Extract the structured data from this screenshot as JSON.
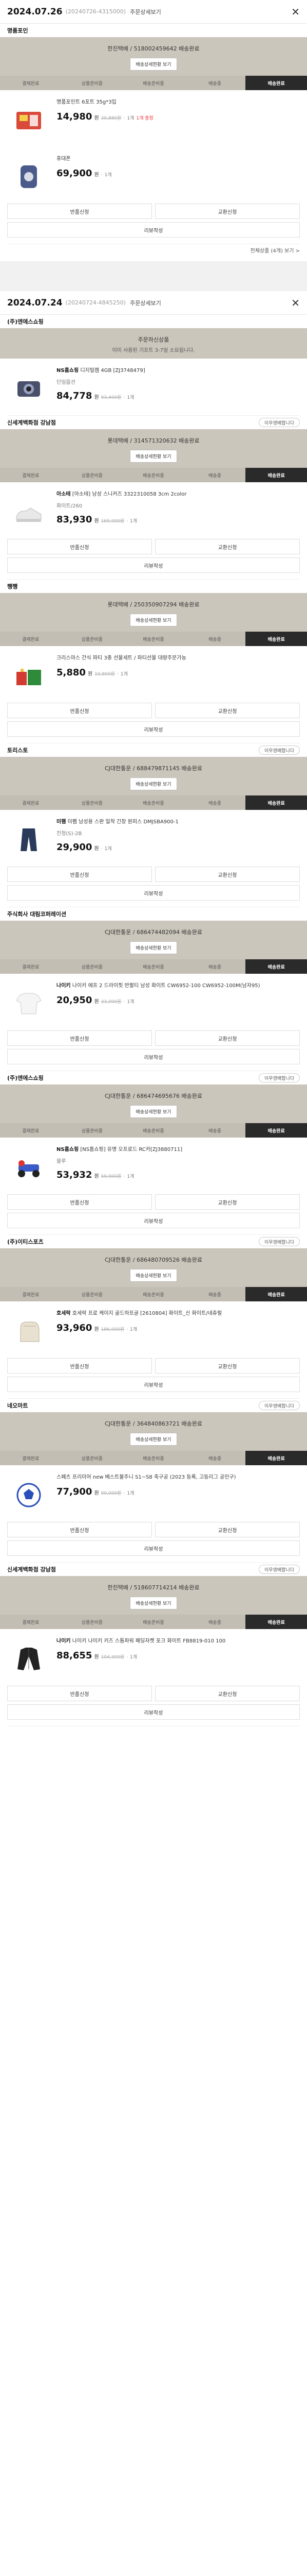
{
  "orders": [
    {
      "date": "2024.07.26",
      "no": "(20240726-4315000)",
      "detail": "주문상세보기",
      "groups": [
        {
          "shop": "명품포인",
          "pill": "",
          "delivery": {
            "title": "한진택배 / 518002459642 배송완료",
            "sub": "",
            "btn": "배송상세현황 보기"
          },
          "steps": [
            "결제완료",
            "상품준비중",
            "배송준비중",
            "배송중",
            "배송완료"
          ],
          "active": 4,
          "products": [
            {
              "brand": "",
              "name": "명품포인트 6포트 35g*3입",
              "opt": "",
              "price": "14,980",
              "old": "30,880원",
              "qty": "1개",
              "note": "1개 증정",
              "thumb": "box",
              "color": "#d94a3a"
            },
            {
              "brand": "",
              "name": "휴대폰",
              "opt": "",
              "price": "69,900",
              "old": "",
              "qty": "1개",
              "note": "",
              "thumb": "phone",
              "color": "#4a5a8a"
            }
          ],
          "actions": [
            "반품신청",
            "교환신청"
          ],
          "wide": "리뷰작성"
        }
      ],
      "more": "전체상품 (4개) 보기 >"
    },
    {
      "date": "2024.07.24",
      "no": "(20240724-4845250)",
      "detail": "주문상세보기",
      "groups": [
        {
          "shop": "(주)엔에스쇼핑",
          "pill": "",
          "delivery": {
            "title": "주문하신상품",
            "sub": "이미 사용된 기프트 3-7일 소요됩니다.",
            "btn": ""
          },
          "steps": [],
          "active": -1,
          "products": [
            {
              "brand": "NS홈쇼핑",
              "name": "디지털캠 4GB [ZJ3748479]",
              "opt": "단일옵션",
              "price": "84,778",
              "old": "93,400원",
              "qty": "1개",
              "note": "",
              "thumb": "cam",
              "color": "#4a4f6a"
            }
          ],
          "actions": [],
          "wide": ""
        },
        {
          "shop": "신세계백화점 강남점",
          "pill": "이우영배합니다",
          "delivery": {
            "title": "롯데택배 / 314571320632 배송완료",
            "sub": "",
            "btn": "배송상세현황 보기"
          },
          "steps": [
            "결제완료",
            "상품준비중",
            "배송준비중",
            "배송중",
            "배송완료"
          ],
          "active": 4,
          "products": [
            {
              "brand": "아소테",
              "name": "[아소테] 남성 스니커즈 3322310058 3cm 2color",
              "opt": "화이트/260",
              "price": "83,930",
              "old": "169,000원",
              "qty": "1개",
              "note": "",
              "thumb": "shoe",
              "color": "#e8e8e8"
            }
          ],
          "actions": [
            "반품신청",
            "교환신청"
          ],
          "wide": "리뷰작성"
        },
        {
          "shop": "쨍쨍",
          "pill": "",
          "delivery": {
            "title": "롯데택배 / 250350907294 배송완료",
            "sub": "",
            "btn": "배송상세현황 보기"
          },
          "steps": [
            "결제완료",
            "상품준비중",
            "배송준비중",
            "배송중",
            "배송완료"
          ],
          "active": 4,
          "products": [
            {
              "brand": "",
              "name": "크리스마스 간식 파티 3종 선물세트 / 파티선물 대량주문가능",
              "opt": "",
              "price": "5,880",
              "old": "10,800원",
              "qty": "1개",
              "note": "",
              "thumb": "gift",
              "color": "#d23b32"
            }
          ],
          "actions": [
            "반품신청",
            "교환신청"
          ],
          "wide": "리뷰작성"
        },
        {
          "shop": "토리스토",
          "pill": "이우영배합니다",
          "delivery": {
            "title": "CJ대한통운 / 688479871145 배송완료",
            "sub": "",
            "btn": "배송상세현황 보기"
          },
          "steps": [
            "결제완료",
            "상품준비중",
            "배송준비중",
            "배송중",
            "배송완료"
          ],
          "active": 4,
          "products": [
            {
              "brand": "미팸",
              "name": "미팸 남성용 스판 밀착 긴장 원피스 DMJSBA900-1",
              "opt": "진청(S)-2B",
              "price": "29,900",
              "old": "",
              "qty": "1개",
              "note": "",
              "thumb": "jeans",
              "color": "#2a3a5a"
            }
          ],
          "actions": [
            "반품신청",
            "교환신청"
          ],
          "wide": "리뷰작성"
        },
        {
          "shop": "주식회사 대림코퍼레이션",
          "pill": "",
          "delivery": {
            "title": "CJ대한통운 / 686474482094 배송완료",
            "sub": "",
            "btn": "배송상세현황 보기"
          },
          "steps": [
            "결제완료",
            "상품준비중",
            "배송준비중",
            "배송중",
            "배송완료"
          ],
          "active": 4,
          "products": [
            {
              "brand": "나이키",
              "name": "나이키 에프 2 드라이핏 반팔티 남성 화이트 CW6952-100 CW6952-100M(남자95)",
              "opt": "",
              "price": "20,950",
              "old": "33,000원",
              "qty": "1개",
              "note": "",
              "thumb": "tee",
              "color": "#f5f5f5"
            }
          ],
          "actions": [
            "반품신청",
            "교환신청"
          ],
          "wide": "리뷰작성"
        },
        {
          "shop": "(주)엔에스쇼핑",
          "pill": "이우영배합니다",
          "delivery": {
            "title": "CJ대한통운 / 686474695676 배송완료",
            "sub": "",
            "btn": "배송상세현황 보기"
          },
          "steps": [
            "결제완료",
            "상품준비중",
            "배송준비중",
            "배송중",
            "배송완료"
          ],
          "active": 4,
          "products": [
            {
              "brand": "NS홈쇼핑",
              "name": "[NS홈쇼핑] 유명 오프로드 RC카[ZJ3880711]",
              "opt": "블루",
              "price": "53,932",
              "old": "59,900원",
              "qty": "1개",
              "note": "",
              "thumb": "rc",
              "color": "#3a5ac8"
            }
          ],
          "actions": [
            "반품신청",
            "교환신청"
          ],
          "wide": "리뷰작성"
        },
        {
          "shop": "(주)이티스포츠",
          "pill": "이우영배합니다",
          "delivery": {
            "title": "CJ대한통운 / 686480709526 배송완료",
            "sub": "",
            "btn": "배송상세현황 보기"
          },
          "steps": [
            "결제완료",
            "상품준비중",
            "배송준비중",
            "배송중",
            "배송완료"
          ],
          "active": 4,
          "products": [
            {
              "brand": "호세락",
              "name": "호세락 프로 케이지 골드하프글 [2610804] 화이트_신 화이트/네츄럴",
              "opt": "",
              "price": "93,960",
              "old": "186,000원",
              "qty": "1개",
              "note": "",
              "thumb": "glove",
              "color": "#e9e1d0"
            }
          ],
          "actions": [
            "반품신청",
            "교환신청"
          ],
          "wide": "리뷰작성"
        },
        {
          "shop": "네오마트",
          "pill": "이우영배합니다",
          "delivery": {
            "title": "CJ대한통운 / 364840863721 배송완료",
            "sub": "",
            "btn": "배송상세현황 보기"
          },
          "steps": [
            "결제완료",
            "상품준비중",
            "배송준비중",
            "배송중",
            "배송완료"
          ],
          "active": 4,
          "products": [
            {
              "brand": "",
              "name": "스페츠 프리미어 new 베스트볼주니 S1~S8 축구공 (2023 등록, 고등리그 공인구)",
              "opt": "",
              "price": "77,900",
              "old": "90,000원",
              "qty": "1개",
              "note": "",
              "thumb": "ball",
              "color": "#2a4fb8"
            }
          ],
          "actions": [
            "반품신청",
            "교환신청"
          ],
          "wide": "리뷰작성"
        },
        {
          "shop": "신세계백화점 강남점",
          "pill": "이우영배합니다",
          "delivery": {
            "title": "한진택배 / 518607714214 배송완료",
            "sub": "",
            "btn": "배송상세현황 보기"
          },
          "steps": [
            "결제완료",
            "상품준비중",
            "배송준비중",
            "배송중",
            "배송완료"
          ],
          "active": 4,
          "products": [
            {
              "brand": "나이키",
              "name": "나이키 나이키 키즈 스톰파워 패딩자켓 포크 화이트 FB8819-010 100",
              "opt": "",
              "price": "88,655",
              "old": "104,300원",
              "qty": "1개",
              "note": "",
              "thumb": "jacket",
              "color": "#222"
            }
          ],
          "actions": [
            "반품신청",
            "교환신청"
          ],
          "wide": "리뷰작성"
        }
      ],
      "more": ""
    }
  ],
  "labels": {
    "won": "원",
    "dot": "·"
  },
  "colors": {
    "delivery_bg": "#cbc6bb",
    "steps_bg": "#c3beb3",
    "active_step": "#2a2a2a"
  }
}
